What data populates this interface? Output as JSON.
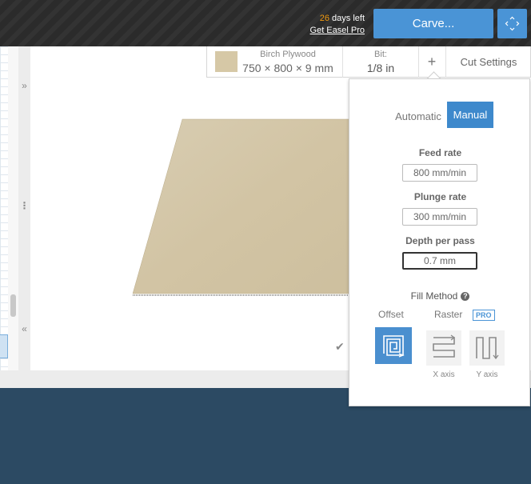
{
  "topbar": {
    "trial_days": "26",
    "trial_suffix": "days left",
    "get_pro_link": "Get Easel Pro",
    "carve_label": "Carve...",
    "expand_icon": "expand-icon"
  },
  "toolbar": {
    "material_name": "Birch Plywood",
    "material_dims": "750 × 800 × 9 mm",
    "bit_label": "Bit:",
    "bit_value": "1/8 in",
    "add_label": "+",
    "cut_settings_label": "Cut Settings"
  },
  "left_strip": {
    "expand_glyph": "»",
    "handle_glyph": "⋮",
    "collapse_glyph": "«"
  },
  "cut_settings": {
    "mode_automatic": "Automatic",
    "mode_manual": "Manual",
    "feed_rate_label": "Feed rate",
    "feed_rate_value": "800 mm/min",
    "plunge_rate_label": "Plunge rate",
    "plunge_rate_value": "300 mm/min",
    "depth_label": "Depth per pass",
    "depth_value": "0.7 mm",
    "fill_method_label": "Fill Method",
    "offset_label": "Offset",
    "raster_label": "Raster",
    "pro_badge": "PRO",
    "x_axis_label": "X axis",
    "y_axis_label": "Y axis"
  },
  "colors": {
    "accent": "#4a94d6",
    "trial_highlight": "#f39c12",
    "material": "#d6c8a6",
    "background": "#2c4a63"
  }
}
